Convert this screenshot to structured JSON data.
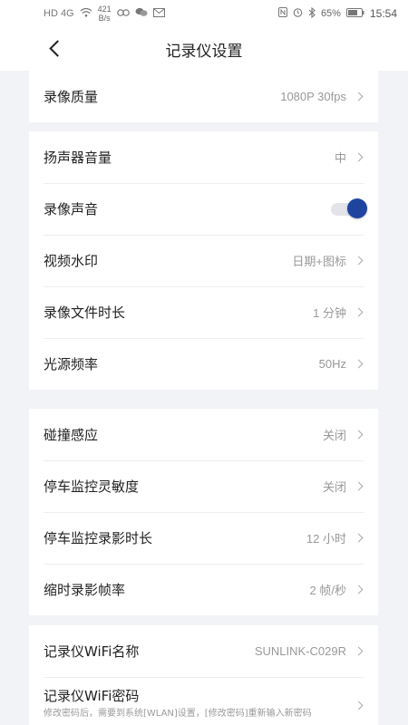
{
  "status_bar": {
    "network": "HD 4G",
    "speed_value": "421",
    "speed_unit": "B/s",
    "battery": "65%",
    "time": "15:54"
  },
  "header": {
    "title": "记录仪设置"
  },
  "sections": [
    {
      "rows": [
        {
          "label": "录像质量",
          "value": "1080P 30fps",
          "type": "nav"
        }
      ]
    },
    {
      "rows": [
        {
          "label": "扬声器音量",
          "value": "中",
          "type": "nav"
        },
        {
          "label": "录像声音",
          "type": "toggle",
          "checked": true
        },
        {
          "label": "视频水印",
          "value": "日期+图标",
          "type": "nav"
        },
        {
          "label": "录像文件时长",
          "value": "1 分钟",
          "type": "nav"
        },
        {
          "label": "光源频率",
          "value": "50Hz",
          "type": "nav"
        }
      ]
    },
    {
      "rows": [
        {
          "label": "碰撞感应",
          "value": "关闭",
          "type": "nav"
        },
        {
          "label": "停车监控灵敏度",
          "value": "关闭",
          "type": "nav"
        },
        {
          "label": "停车监控录影时长",
          "value": "12 小时",
          "type": "nav"
        },
        {
          "label": "缩时录影帧率",
          "value": "2 帧/秒",
          "type": "nav"
        }
      ]
    },
    {
      "rows": [
        {
          "label": "记录仪WiFi名称",
          "value": "SUNLINK-C029R",
          "type": "nav"
        },
        {
          "label": "记录仪WiFi密码",
          "hint": "修改密码后，需要到系统[WLAN]设置，[修改密码]重新输入新密码",
          "type": "nav"
        }
      ]
    }
  ],
  "colors": {
    "accent": "#1e44a0",
    "background": "#f1f3f6"
  }
}
